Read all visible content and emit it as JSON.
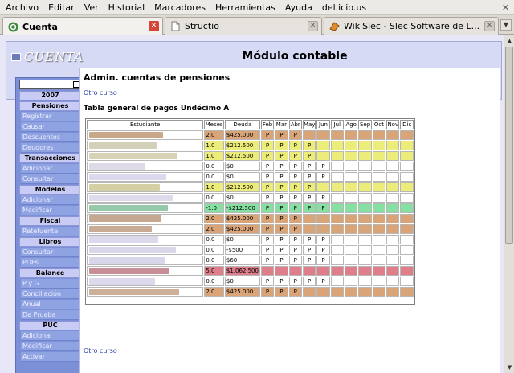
{
  "menubar": {
    "items": [
      "Archivo",
      "Editar",
      "Ver",
      "Historial",
      "Marcadores",
      "Herramientas",
      "Ayuda",
      "del.icio.us"
    ]
  },
  "tabs": [
    {
      "label": "Cuenta",
      "icon": "cuenta-app-icon",
      "active": true
    },
    {
      "label": "Structio",
      "icon": "page-icon",
      "active": false
    },
    {
      "label": "WikiSlec - Slec Software de L...",
      "icon": "wiki-icon",
      "active": false
    }
  ],
  "page": {
    "logo_text": "CUENTA",
    "title": "Módulo contable"
  },
  "sidebar": {
    "blocks": [
      {
        "kind": "section",
        "label": "2007"
      },
      {
        "kind": "section",
        "label": "Pensiones"
      },
      {
        "kind": "item",
        "label": "Registrar"
      },
      {
        "kind": "item",
        "label": "Causar"
      },
      {
        "kind": "item",
        "label": "Descuentos"
      },
      {
        "kind": "item",
        "label": "Deudores"
      },
      {
        "kind": "section",
        "label": "Transacciones"
      },
      {
        "kind": "item",
        "label": "Adicionar"
      },
      {
        "kind": "item",
        "label": "Consultar"
      },
      {
        "kind": "section",
        "label": "Modelos"
      },
      {
        "kind": "item",
        "label": "Adicionar"
      },
      {
        "kind": "item",
        "label": "Modificar"
      },
      {
        "kind": "section",
        "label": "Fiscal"
      },
      {
        "kind": "item",
        "label": "Retefuente"
      },
      {
        "kind": "section",
        "label": "Libros"
      },
      {
        "kind": "item",
        "label": "Consultar"
      },
      {
        "kind": "item",
        "label": "PDFs"
      },
      {
        "kind": "section",
        "label": "Balance"
      },
      {
        "kind": "item",
        "label": "P y G"
      },
      {
        "kind": "item",
        "label": "Conciliación"
      },
      {
        "kind": "item",
        "label": "Anual"
      },
      {
        "kind": "item",
        "label": "De Prueba"
      },
      {
        "kind": "section",
        "label": "PUC"
      },
      {
        "kind": "item",
        "label": "Adicionar"
      },
      {
        "kind": "item",
        "label": "Modificar"
      },
      {
        "kind": "item",
        "label": "Activar"
      }
    ]
  },
  "main": {
    "heading": "Admin. cuentas de pensiones",
    "other_course_top": "Otro curso",
    "table_title": "Tabla general de pagos Undécimo A",
    "other_course_bottom": "Otro curso",
    "columns": [
      "Estudiante",
      "Meses",
      "Deuda",
      "Feb",
      "Mar",
      "Abr",
      "May",
      "Jun",
      "Jul",
      "Ago",
      "Sep",
      "Oct",
      "Nov",
      "Dic"
    ],
    "paid_mark": "P",
    "colors": {
      "brown": "#d9a477",
      "yellow": "#ecec7a",
      "white": "#ffffff",
      "green": "#86e0a2",
      "red": "#df7e8b"
    },
    "rows": [
      {
        "meses": "2.0",
        "deuda": "$425.000",
        "paid": 3,
        "color": "brown"
      },
      {
        "meses": "1.0",
        "deuda": "$212.500",
        "paid": 4,
        "color": "yellow"
      },
      {
        "meses": "1.0",
        "deuda": "$212.500",
        "paid": 4,
        "color": "yellow"
      },
      {
        "meses": "0.0",
        "deuda": "$0",
        "paid": 5,
        "color": "white"
      },
      {
        "meses": "0.0",
        "deuda": "$0",
        "paid": 5,
        "color": "white"
      },
      {
        "meses": "1.0",
        "deuda": "$212.500",
        "paid": 4,
        "color": "yellow"
      },
      {
        "meses": "0.0",
        "deuda": "$0",
        "paid": 5,
        "color": "white"
      },
      {
        "meses": "-1.0",
        "deuda": "-$212.500",
        "paid": 5,
        "color": "green"
      },
      {
        "meses": "2.0",
        "deuda": "$425.000",
        "paid": 3,
        "color": "brown"
      },
      {
        "meses": "2.0",
        "deuda": "$425.000",
        "paid": 3,
        "color": "brown"
      },
      {
        "meses": "0.0",
        "deuda": "$0",
        "paid": 5,
        "color": "white"
      },
      {
        "meses": "0.0",
        "deuda": "-$500",
        "paid": 5,
        "color": "white"
      },
      {
        "meses": "0.0",
        "deuda": "$60",
        "paid": 5,
        "color": "white"
      },
      {
        "meses": "5.0",
        "deuda": "$1.062.500",
        "paid": 0,
        "color": "red"
      },
      {
        "meses": "0.0",
        "deuda": "$0",
        "paid": 5,
        "color": "white"
      },
      {
        "meses": "2.0",
        "deuda": "$425.000",
        "paid": 3,
        "color": "brown"
      }
    ]
  }
}
